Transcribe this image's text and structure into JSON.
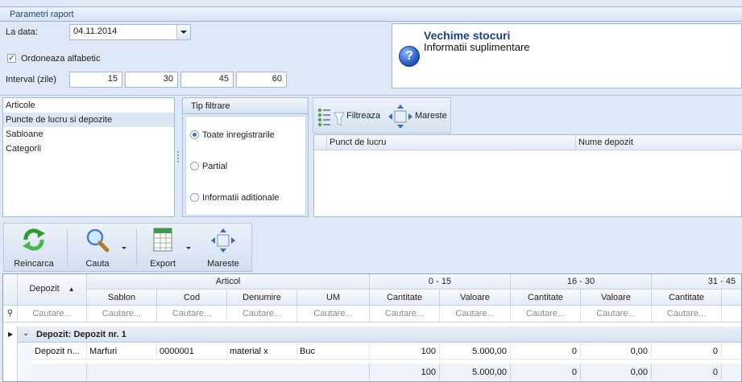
{
  "params": {
    "header": "Parametri raport",
    "date_label": "La data:",
    "date_value": "04.11.2014",
    "sort_label": "Ordoneaza alfabetic",
    "sort_checked": true,
    "interval_label": "Interval (zile)",
    "intervals": [
      "15",
      "30",
      "45",
      "60"
    ]
  },
  "info": {
    "title": "Vechime stocuri",
    "subtitle": "Informatii suplimentare"
  },
  "filter_list": {
    "items": [
      "Articole",
      "Puncte de lucru si depozite",
      "Sabloane",
      "Categorii"
    ],
    "selected_index": 1
  },
  "tip_filtrare": {
    "header": "Tip filtrare",
    "options": [
      "Toate inregistrarile",
      "Partial",
      "Informatii aditionale"
    ],
    "selected_index": 0
  },
  "right_filter": {
    "filter_label": "Filtreaza",
    "expand_label": "Mareste",
    "columns": [
      "Punct de lucru",
      "Nume depozit"
    ]
  },
  "toolbar": {
    "reload_label": "Reincarca",
    "search_label": "Cauta",
    "export_label": "Export",
    "expand_label": "Mareste"
  },
  "grid": {
    "group_header_articol": "Articol",
    "col_depozit": "Depozit",
    "group_headers": [
      "0 - 15",
      "16 - 30",
      "31 - 45"
    ],
    "columns": [
      "Sablon",
      "Cod",
      "Denumire",
      "UM"
    ],
    "sub_columns": [
      "Cantitate",
      "Valoare"
    ],
    "search_placeholder": "Cautare...",
    "group_row_label": "Depozit: Depozit nr. 1",
    "row": {
      "depozit": "Depozit n...",
      "sablon": "Marfuri",
      "cod": "0000001",
      "denumire": "material x",
      "um": "Buc",
      "cant_0_15": "100",
      "val_0_15": "5.000,00",
      "cant_16_30": "0",
      "val_16_30": "0,00",
      "cant_31_45": "0"
    },
    "footer": {
      "cant_0_15": "100",
      "val_0_15": "5.000,00",
      "cant_16_30": "0",
      "val_16_30": "0,00",
      "cant_31_45": "0"
    }
  },
  "colors": {
    "background": "#dfe8f6",
    "header_text": "#15428b",
    "border": "#a3b9d5"
  }
}
